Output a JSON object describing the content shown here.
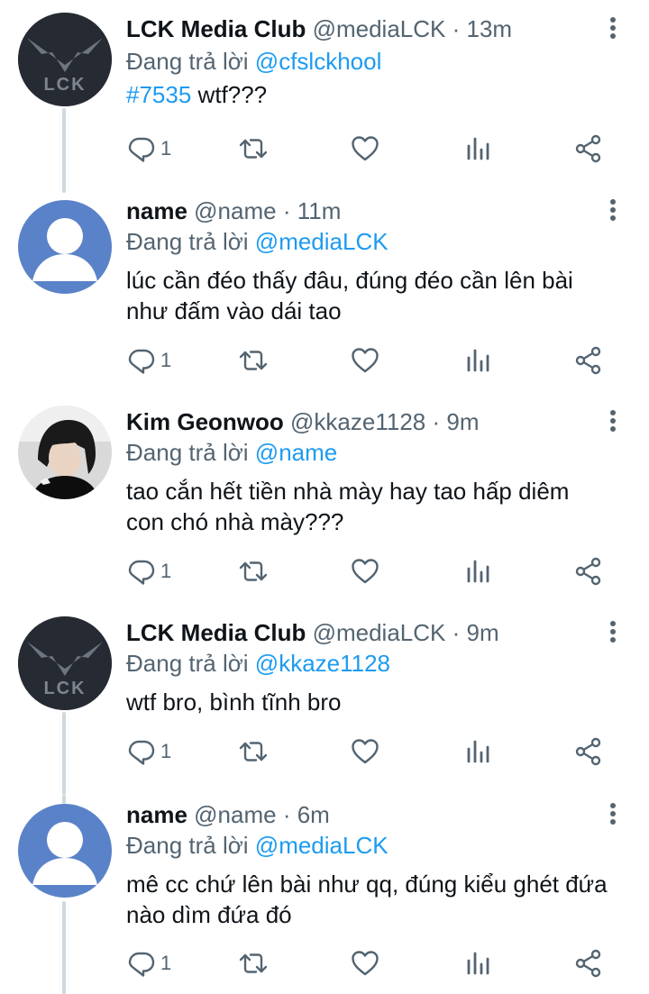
{
  "tweets": [
    {
      "name": "LCK Media Club",
      "handle": "@mediaLCK",
      "time": "13m",
      "reply_prefix": "Đang trả lời",
      "reply_to": "@cfslckhool",
      "hashtag": "#7535",
      "text": " wtf???",
      "reply_count": "1",
      "avatar": "lck-logo"
    },
    {
      "name": "name",
      "handle": "@name",
      "time": "11m",
      "reply_prefix": "Đang trả lời",
      "reply_to": "@mediaLCK",
      "hashtag": "",
      "text": "lúc cần đéo thấy đâu, đúng đéo cần lên bài như đấm vào dái tao",
      "reply_count": "1",
      "avatar": "default-user"
    },
    {
      "name": "Kim Geonwoo",
      "handle": "@kkaze1128",
      "time": "9m",
      "reply_prefix": "Đang trả lời",
      "reply_to": "@name",
      "hashtag": "",
      "text": "tao cắn hết tiền nhà mày hay tao hấp diêm con chó nhà mày???",
      "reply_count": "1",
      "avatar": "photo"
    },
    {
      "name": "LCK Media Club",
      "handle": "@mediaLCK",
      "time": "9m",
      "reply_prefix": "Đang trả lời",
      "reply_to": "@kkaze1128",
      "hashtag": "",
      "text": "wtf bro, bình tĩnh bro",
      "reply_count": "1",
      "avatar": "lck-logo"
    },
    {
      "name": "name",
      "handle": "@name",
      "time": "6m",
      "reply_prefix": "Đang trả lời",
      "reply_to": "@mediaLCK",
      "hashtag": "",
      "text": "mê cc chứ lên bài như qq, đúng kiểu ghét đứa nào dìm đứa đó",
      "reply_count": "1",
      "avatar": "default-user"
    }
  ],
  "colors": {
    "link": "#1d9bf0",
    "meta": "#536471",
    "thread_line": "#cfd9de"
  },
  "icons": [
    "reply-icon",
    "retweet-icon",
    "like-icon",
    "views-icon",
    "share-icon",
    "more-icon"
  ]
}
